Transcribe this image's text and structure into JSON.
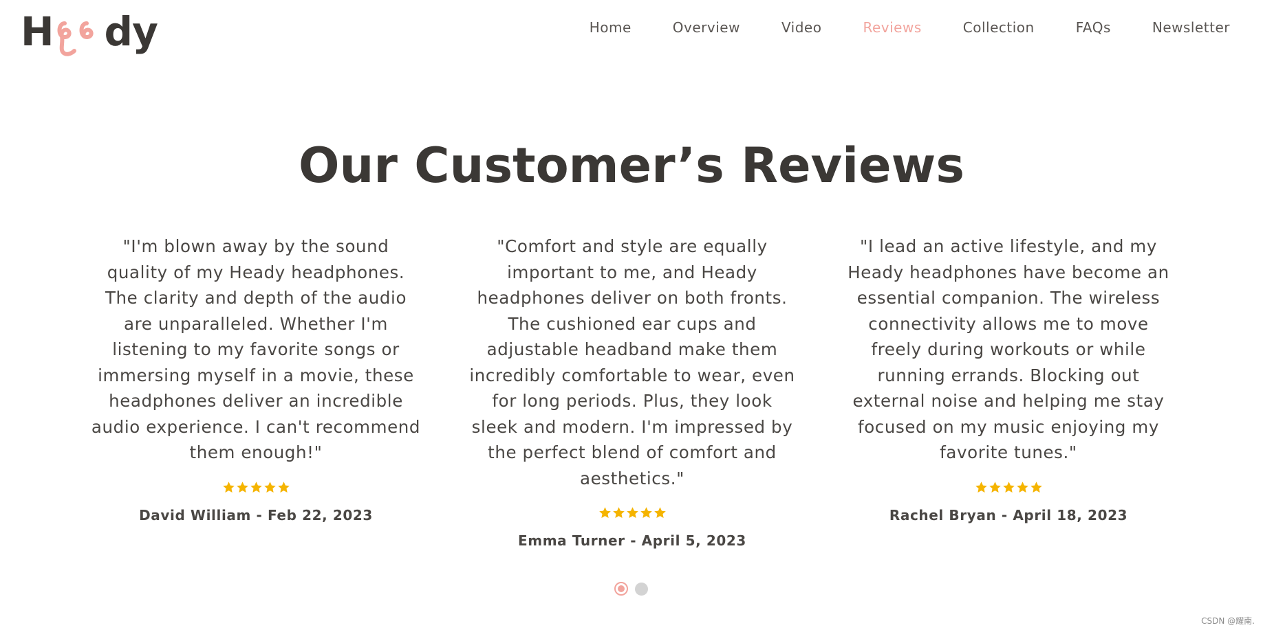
{
  "brand": {
    "logo_text_prefix": "H",
    "logo_text_suffix": "dy",
    "accent_color": "#f2a49d",
    "text_color": "#3b3835",
    "star_color": "#f5b400"
  },
  "nav": {
    "items": [
      {
        "label": "Home",
        "active": false
      },
      {
        "label": "Overview",
        "active": false
      },
      {
        "label": "Video",
        "active": false
      },
      {
        "label": "Reviews",
        "active": true
      },
      {
        "label": "Collection",
        "active": false
      },
      {
        "label": "FAQs",
        "active": false
      },
      {
        "label": "Newsletter",
        "active": false
      }
    ]
  },
  "main": {
    "title": "Our Customer’s Reviews",
    "reviews": [
      {
        "text": "\"I'm blown away by the sound quality of my Heady headphones. The clarity and depth of the audio are unparalleled. Whether I'm listening to my favorite songs or immersing myself in a movie, these headphones deliver an incredible audio experience. I can't recommend them enough!\"",
        "rating": 5,
        "meta": "David William - Feb 22, 2023"
      },
      {
        "text": "\"Comfort and style are equally important to me, and Heady headphones deliver on both fronts. The cushioned ear cups and adjustable headband make them incredibly comfortable to wear, even for long periods. Plus, they look sleek and modern. I'm impressed by the perfect blend of comfort and aesthetics.\"",
        "rating": 5,
        "meta": "Emma Turner - April 5, 2023"
      },
      {
        "text": "\"I lead an active lifestyle, and my Heady headphones have become an essential companion. The wireless connectivity allows me to move freely during workouts or while running errands. Blocking out external noise and helping me stay focused on my music enjoying my favorite tunes.\"",
        "rating": 5,
        "meta": "Rachel Bryan - April 18, 2023"
      }
    ],
    "pagination": {
      "total": 2,
      "current": 1
    }
  },
  "footer": {
    "watermark": "CSDN @耀南."
  }
}
